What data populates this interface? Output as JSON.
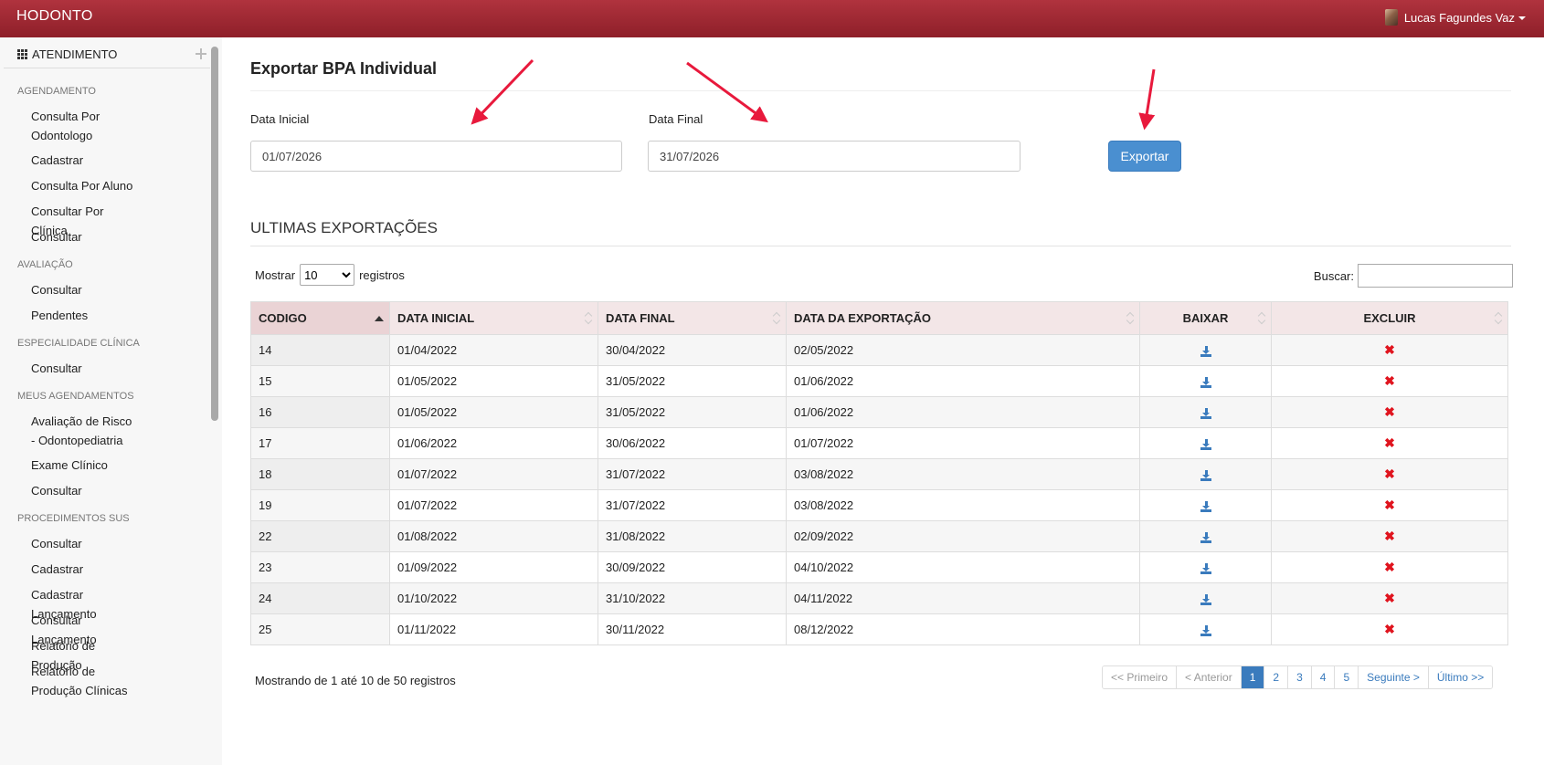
{
  "app": {
    "brand": "HODONTO",
    "user_name": "Lucas Fagundes Vaz"
  },
  "sidebar": {
    "header": "ATENDIMENTO",
    "sections": [
      {
        "title": "AGENDAMENTO",
        "items": [
          "Consulta Por Odontologo",
          "Cadastrar",
          "Consulta Por Aluno",
          "Consultar Por Clínica",
          "Consultar"
        ]
      },
      {
        "title": "AVALIAÇÃO",
        "items": [
          "Consultar",
          "Pendentes"
        ]
      },
      {
        "title": "ESPECIALIDADE CLÍNICA",
        "items": [
          "Consultar"
        ]
      },
      {
        "title": "MEUS AGENDAMENTOS",
        "items": [
          "Avaliação de Risco - Odontopediatria",
          "Exame Clínico",
          "Consultar"
        ]
      },
      {
        "title": "PROCEDIMENTOS SUS",
        "items": [
          "Consultar",
          "Cadastrar",
          "Cadastrar Lançamento",
          "Consultar Lançamento",
          "Relatório de Produção",
          "Relatório de Produção Clínicas"
        ]
      }
    ]
  },
  "form": {
    "title": "Exportar BPA Individual",
    "start_label": "Data Inicial",
    "start_value": "01/07/2026",
    "end_label": "Data Final",
    "end_value": "31/07/2026",
    "export_button": "Exportar"
  },
  "exports": {
    "title": "ULTIMAS EXPORTAÇÕES",
    "length_prefix": "Mostrar",
    "length_value": "10",
    "length_suffix": "registros",
    "search_label": "Buscar:",
    "columns": [
      "CODIGO",
      "DATA INICIAL",
      "DATA FINAL",
      "DATA DA EXPORTAÇÃO",
      "BAIXAR",
      "EXCLUIR"
    ],
    "rows": [
      [
        "14",
        "01/04/2022",
        "30/04/2022",
        "02/05/2022"
      ],
      [
        "15",
        "01/05/2022",
        "31/05/2022",
        "01/06/2022"
      ],
      [
        "16",
        "01/05/2022",
        "31/05/2022",
        "01/06/2022"
      ],
      [
        "17",
        "01/06/2022",
        "30/06/2022",
        "01/07/2022"
      ],
      [
        "18",
        "01/07/2022",
        "31/07/2022",
        "03/08/2022"
      ],
      [
        "19",
        "01/07/2022",
        "31/07/2022",
        "03/08/2022"
      ],
      [
        "22",
        "01/08/2022",
        "31/08/2022",
        "02/09/2022"
      ],
      [
        "23",
        "01/09/2022",
        "30/09/2022",
        "04/10/2022"
      ],
      [
        "24",
        "01/10/2022",
        "31/10/2022",
        "04/11/2022"
      ],
      [
        "25",
        "01/11/2022",
        "30/11/2022",
        "08/12/2022"
      ]
    ],
    "info": "Mostrando de 1 até 10 de 50 registros",
    "pagination": [
      "<< Primeiro",
      "< Anterior",
      "1",
      "2",
      "3",
      "4",
      "5",
      "Seguinte >",
      "Último >>"
    ],
    "active_page": "1"
  },
  "colors": {
    "header": "#9e2a34",
    "accent": "#3a7bbd",
    "delete": "#e0141e",
    "annotation_arrow": "#e8193c"
  }
}
